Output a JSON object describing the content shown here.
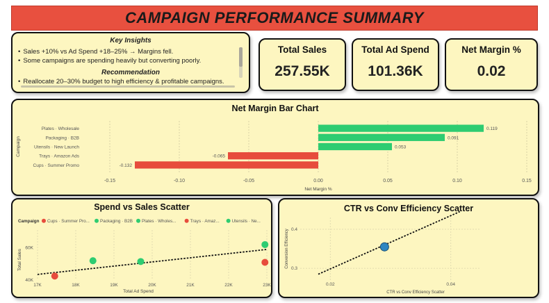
{
  "header": {
    "title": "CAMPAIGN PERFORMANCE SUMMARY"
  },
  "insights": {
    "heading": "Key Insights",
    "items": [
      "Sales +10% vs Ad Spend +18–25% → Margins fell.",
      "Some campaigns are spending heavily but converting poorly."
    ],
    "recommendation_heading": "Recommendation",
    "recommendation_items": [
      "Reallocate 20–30% budget to high efficiency & profitable campaigns."
    ]
  },
  "kpis": [
    {
      "label": "Total Sales",
      "value": "257.55K"
    },
    {
      "label": "Total Ad Spend",
      "value": "101.36K"
    },
    {
      "label": "Net Margin %",
      "value": "0.02"
    }
  ],
  "colors": {
    "positive": "#2ecc71",
    "negative": "#e74c3c",
    "trend": "#111111",
    "highlight": "#2e86c1",
    "card_bg": "#fdf6c0",
    "title_bg": "#e8503f"
  },
  "chart_data": [
    {
      "type": "bar",
      "orientation": "horizontal",
      "title": "Net Margin Bar Chart",
      "xlabel": "Net Margin %",
      "ylabel": "Campaign",
      "xlim": [
        -0.15,
        0.15
      ],
      "xticks": [
        -0.15,
        -0.1,
        -0.05,
        0.0,
        0.05,
        0.1,
        0.15
      ],
      "xtick_labels": [
        "-0.15",
        "-0.10",
        "-0.05",
        "0.00",
        "0.05",
        "0.10",
        "0.15"
      ],
      "categories": [
        "Plates · Wholesale",
        "Packaging · B2B",
        "Utensils · New Launch",
        "Trays · Amazon Ads",
        "Cups · Summer Promo"
      ],
      "values": [
        0.119,
        0.091,
        0.053,
        -0.065,
        -0.132
      ],
      "value_labels": [
        "0.119",
        "0.091",
        "0.053",
        "-0.065",
        "-0.132"
      ],
      "grid": true
    },
    {
      "type": "scatter",
      "title": "Spend vs Sales Scatter",
      "xlabel": "Total Ad Spend",
      "ylabel": "Total Sales",
      "legend_title": "Campaign",
      "legend": [
        {
          "name": "Cups · Summer Pro...",
          "color": "#e74c3c"
        },
        {
          "name": "Packaging · B2B",
          "color": "#2ecc71"
        },
        {
          "name": "Plates · Wholes...",
          "color": "#2ecc71"
        },
        {
          "name": "Trays · Amaz...",
          "color": "#e74c3c"
        },
        {
          "name": "Utensils · Ne...",
          "color": "#2ecc71"
        }
      ],
      "xlim": [
        17000,
        23000
      ],
      "ylim": [
        40000,
        65000
      ],
      "xticks": [
        17000,
        18000,
        19000,
        20000,
        21000,
        22000,
        23000
      ],
      "xtick_labels": [
        "17K",
        "18K",
        "19K",
        "20K",
        "21K",
        "22K",
        "23K"
      ],
      "yticks": [
        40000,
        60000
      ],
      "ytick_labels": [
        "40K",
        "60K"
      ],
      "points": [
        {
          "x": 17450,
          "y": 42500,
          "color": "#e74c3c"
        },
        {
          "x": 18450,
          "y": 52000,
          "color": "#2ecc71"
        },
        {
          "x": 19700,
          "y": 51500,
          "color": "#2ecc71"
        },
        {
          "x": 22950,
          "y": 51000,
          "color": "#e74c3c"
        },
        {
          "x": 22950,
          "y": 62000,
          "color": "#2ecc71"
        }
      ],
      "trendline": [
        [
          17000,
          43500
        ],
        [
          23000,
          59000
        ]
      ]
    },
    {
      "type": "scatter",
      "title": "CTR vs Conv Efficiency Scatter",
      "xlabel": "CTR vs Conv Efficiency Scatter",
      "ylabel": "Conversion Efficiency",
      "xlim": [
        0.015,
        0.045
      ],
      "ylim": [
        0.27,
        0.43
      ],
      "xticks": [
        0.02,
        0.04
      ],
      "xtick_labels": [
        "0.02",
        "0.04"
      ],
      "yticks": [
        0.3,
        0.4
      ],
      "ytick_labels": [
        "0.3",
        "0.4"
      ],
      "points": [
        {
          "x": 0.029,
          "y": 0.355,
          "color": "#2e86c1"
        }
      ],
      "trendline": [
        [
          0.018,
          0.285
        ],
        [
          0.0415,
          0.445
        ]
      ]
    }
  ]
}
